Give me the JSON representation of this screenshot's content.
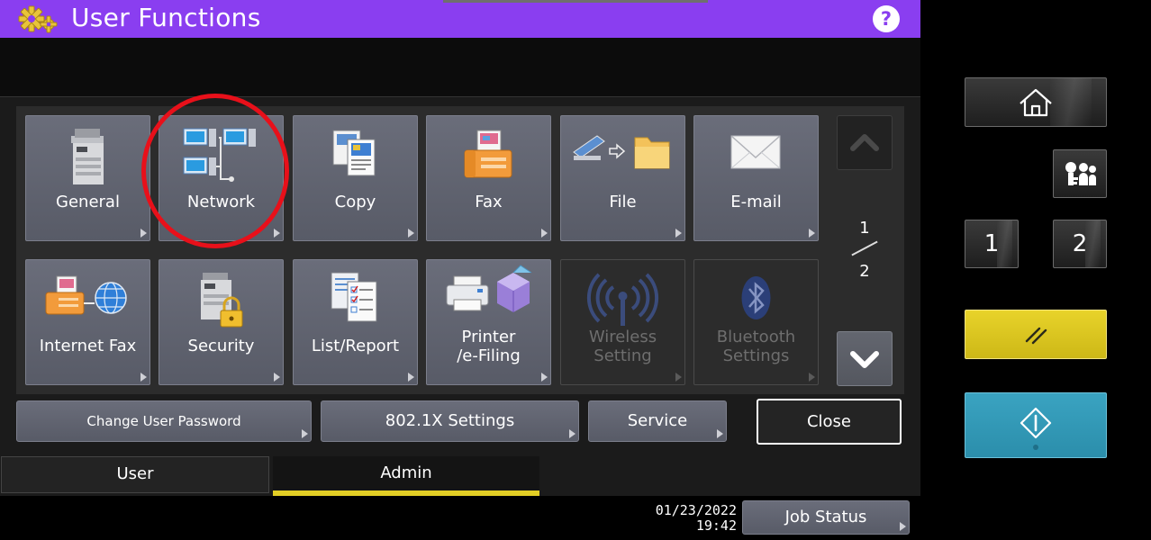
{
  "header": {
    "title": "User Functions",
    "help_label": "?"
  },
  "tiles": [
    {
      "id": "general",
      "label": "General",
      "icon": "copier-icon",
      "enabled": true
    },
    {
      "id": "network",
      "label": "Network",
      "icon": "network-icon",
      "enabled": true
    },
    {
      "id": "copy",
      "label": "Copy",
      "icon": "copy-icon",
      "enabled": true
    },
    {
      "id": "fax",
      "label": "Fax",
      "icon": "fax-icon",
      "enabled": true
    },
    {
      "id": "file",
      "label": "File",
      "icon": "file-folder-icon",
      "enabled": true
    },
    {
      "id": "email",
      "label": "E-mail",
      "icon": "envelope-icon",
      "enabled": true
    },
    {
      "id": "internet-fax",
      "label": "Internet Fax",
      "icon": "internet-fax-icon",
      "enabled": true
    },
    {
      "id": "security",
      "label": "Security",
      "icon": "lock-copier-icon",
      "enabled": true
    },
    {
      "id": "list-report",
      "label": "List/Report",
      "icon": "report-icon",
      "enabled": true
    },
    {
      "id": "printer-efiling",
      "label_line1": "Printer",
      "label_line2": "/e-Filing",
      "icon": "printer-box-icon",
      "enabled": true
    },
    {
      "id": "wireless-setting",
      "label_line1": "Wireless",
      "label_line2": "Setting",
      "icon": "wireless-icon",
      "enabled": false
    },
    {
      "id": "bluetooth-settings",
      "label_line1": "Bluetooth",
      "label_line2": "Settings",
      "icon": "bluetooth-icon",
      "enabled": false
    }
  ],
  "pagination": {
    "current": "1",
    "total": "2"
  },
  "actions": {
    "change_password": "Change User Password",
    "dot1x": "802.1X Settings",
    "service": "Service",
    "close": "Close"
  },
  "tabs": {
    "user": "User",
    "admin": "Admin",
    "active": "admin"
  },
  "status": {
    "date": "01/23/2022",
    "time": "19:42",
    "job_status": "Job Status"
  },
  "hardware_panel": {
    "home": "home-icon",
    "user_info": "user-info-icon",
    "key1": "1",
    "key2": "2",
    "reset": "reset-icon",
    "start": "start-icon"
  },
  "colors": {
    "title_bar": "#8a3ef0",
    "active_tab_underline": "#e2ce25",
    "highlight_circle": "#e8101a",
    "reset_key": "#e0cb22",
    "start_key": "#35a0bf"
  }
}
